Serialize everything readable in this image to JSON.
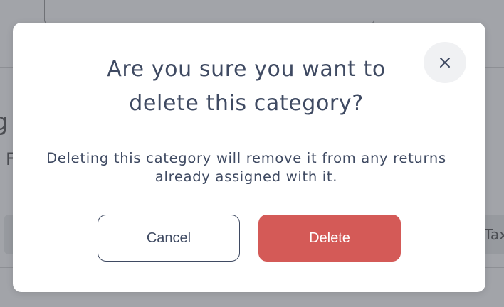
{
  "background": {
    "partial_text_left_1": "g",
    "partial_text_left_2": "F",
    "partial_text_right": "Tax"
  },
  "modal": {
    "title_line1": "Are you sure you want to",
    "title_line2": "delete this category?",
    "body_line1": "Deleting this category will remove it from any returns",
    "body_line2": "already assigned with it.",
    "close_icon": "close-icon",
    "cancel_label": "Cancel",
    "delete_label": "Delete"
  },
  "colors": {
    "overlay": "#a2a4a9",
    "text": "#3f4a62",
    "danger": "#d45a57",
    "close_bg": "#f0f1f3"
  }
}
